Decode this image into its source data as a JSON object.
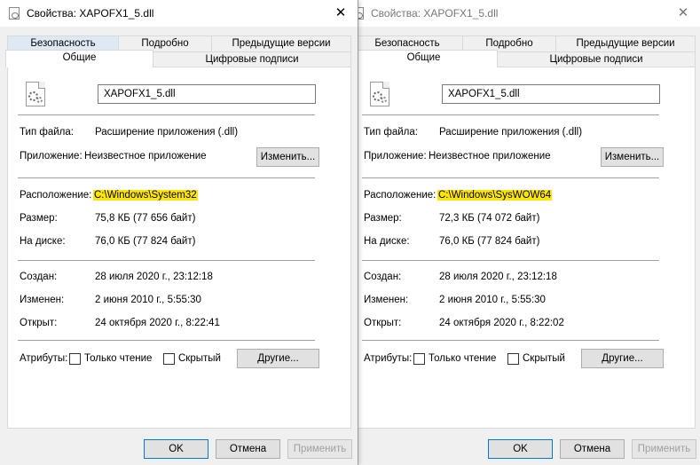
{
  "windows": [
    {
      "title": "Свойства: XAPOFX1_5.dll",
      "tabs_row1": [
        "Безопасность",
        "Подробно",
        "Предыдущие версии"
      ],
      "tabs_row2": [
        "Общие",
        "Цифровые подписи"
      ],
      "filename": "XAPOFX1_5.dll",
      "file_type_label": "Тип файла:",
      "file_type": "Расширение приложения (.dll)",
      "app_label": "Приложение:",
      "app": "Неизвестное приложение",
      "change_button": "Изменить...",
      "location_label": "Расположение:",
      "location": "C:\\Windows\\System32",
      "size_label": "Размер:",
      "size": "75,8 КБ (77 656 байт)",
      "disk_label": "На диске:",
      "disk_size": "76,0 КБ (77 824 байт)",
      "created_label": "Создан:",
      "created": "28 июля 2020 г., 23:12:18",
      "modified_label": "Изменен:",
      "modified": "2 июня 2010 г., 5:55:30",
      "accessed_label": "Открыт:",
      "accessed": "24 октября 2020 г., 8:22:41",
      "attributes_label": "Атрибуты:",
      "readonly_label": "Только чтение",
      "hidden_label": "Скрытый",
      "other_button": "Другие...",
      "ok_button": "OK",
      "cancel_button": "Отмена",
      "apply_button": "Применить"
    },
    {
      "title": "Свойства: XAPOFX1_5.dll",
      "tabs_row1": [
        "Безопасность",
        "Подробно",
        "Предыдущие версии"
      ],
      "tabs_row2": [
        "Общие",
        "Цифровые подписи"
      ],
      "filename": "XAPOFX1_5.dll",
      "file_type_label": "Тип файла:",
      "file_type": "Расширение приложения (.dll)",
      "app_label": "Приложение:",
      "app": "Неизвестное приложение",
      "change_button": "Изменить...",
      "location_label": "Расположение:",
      "location": "C:\\Windows\\SysWOW64",
      "size_label": "Размер:",
      "size": "72,3 КБ (74 072 байт)",
      "disk_label": "На диске:",
      "disk_size": "76,0 КБ (77 824 байт)",
      "created_label": "Создан:",
      "created": "28 июля 2020 г., 23:12:18",
      "modified_label": "Изменен:",
      "modified": "2 июня 2010 г., 5:55:30",
      "accessed_label": "Открыт:",
      "accessed": "24 октября 2020 г., 8:22:02",
      "attributes_label": "Атрибуты:",
      "readonly_label": "Только чтение",
      "hidden_label": "Скрытый",
      "other_button": "Другие...",
      "ok_button": "OK",
      "cancel_button": "Отмена",
      "apply_button": "Применить"
    }
  ],
  "colors": {
    "highlight": "#ffe500",
    "dialog_bg": "#f0f0f0",
    "primary_border": "#0078d7"
  }
}
